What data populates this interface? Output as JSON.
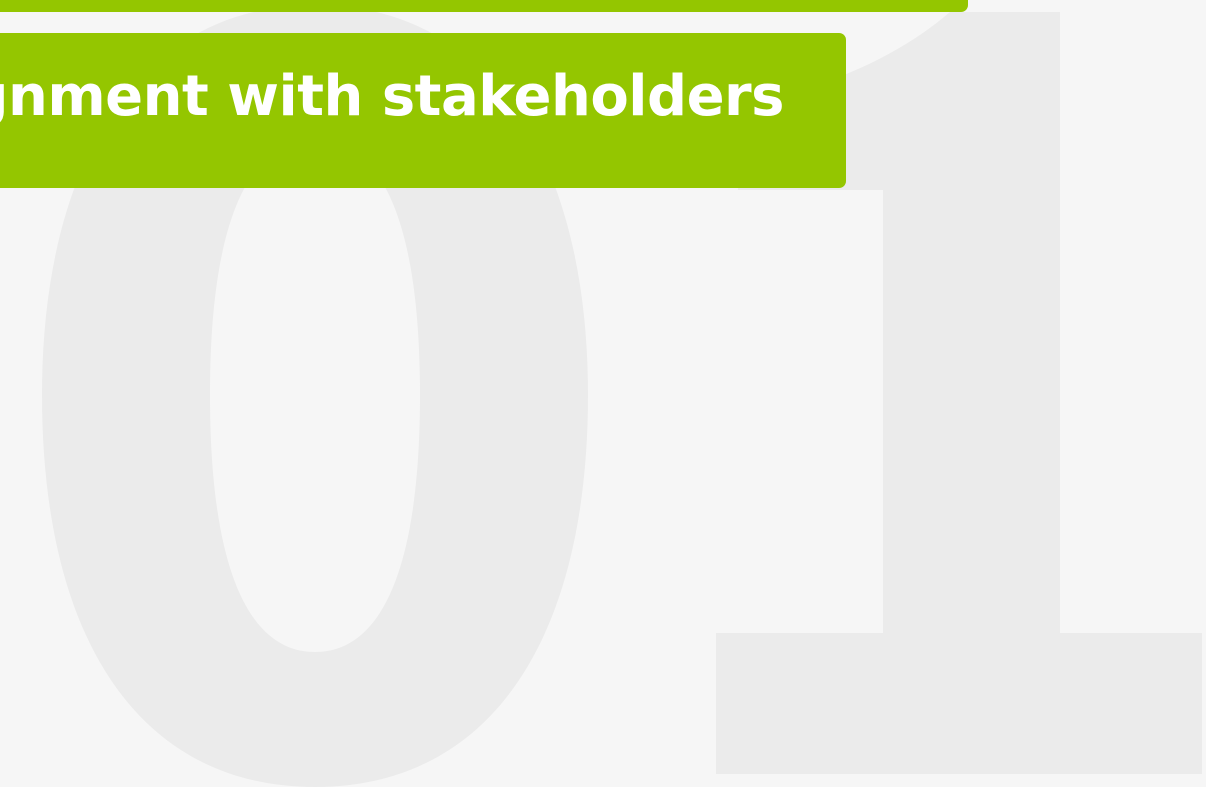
{
  "slide": {
    "background_numeral": "01",
    "heading": "gnment with stakeholders"
  },
  "colors": {
    "background": "#f6f6f6",
    "numeral": "#ebebeb",
    "accent": "#94c600",
    "heading_text": "#ffffff"
  }
}
